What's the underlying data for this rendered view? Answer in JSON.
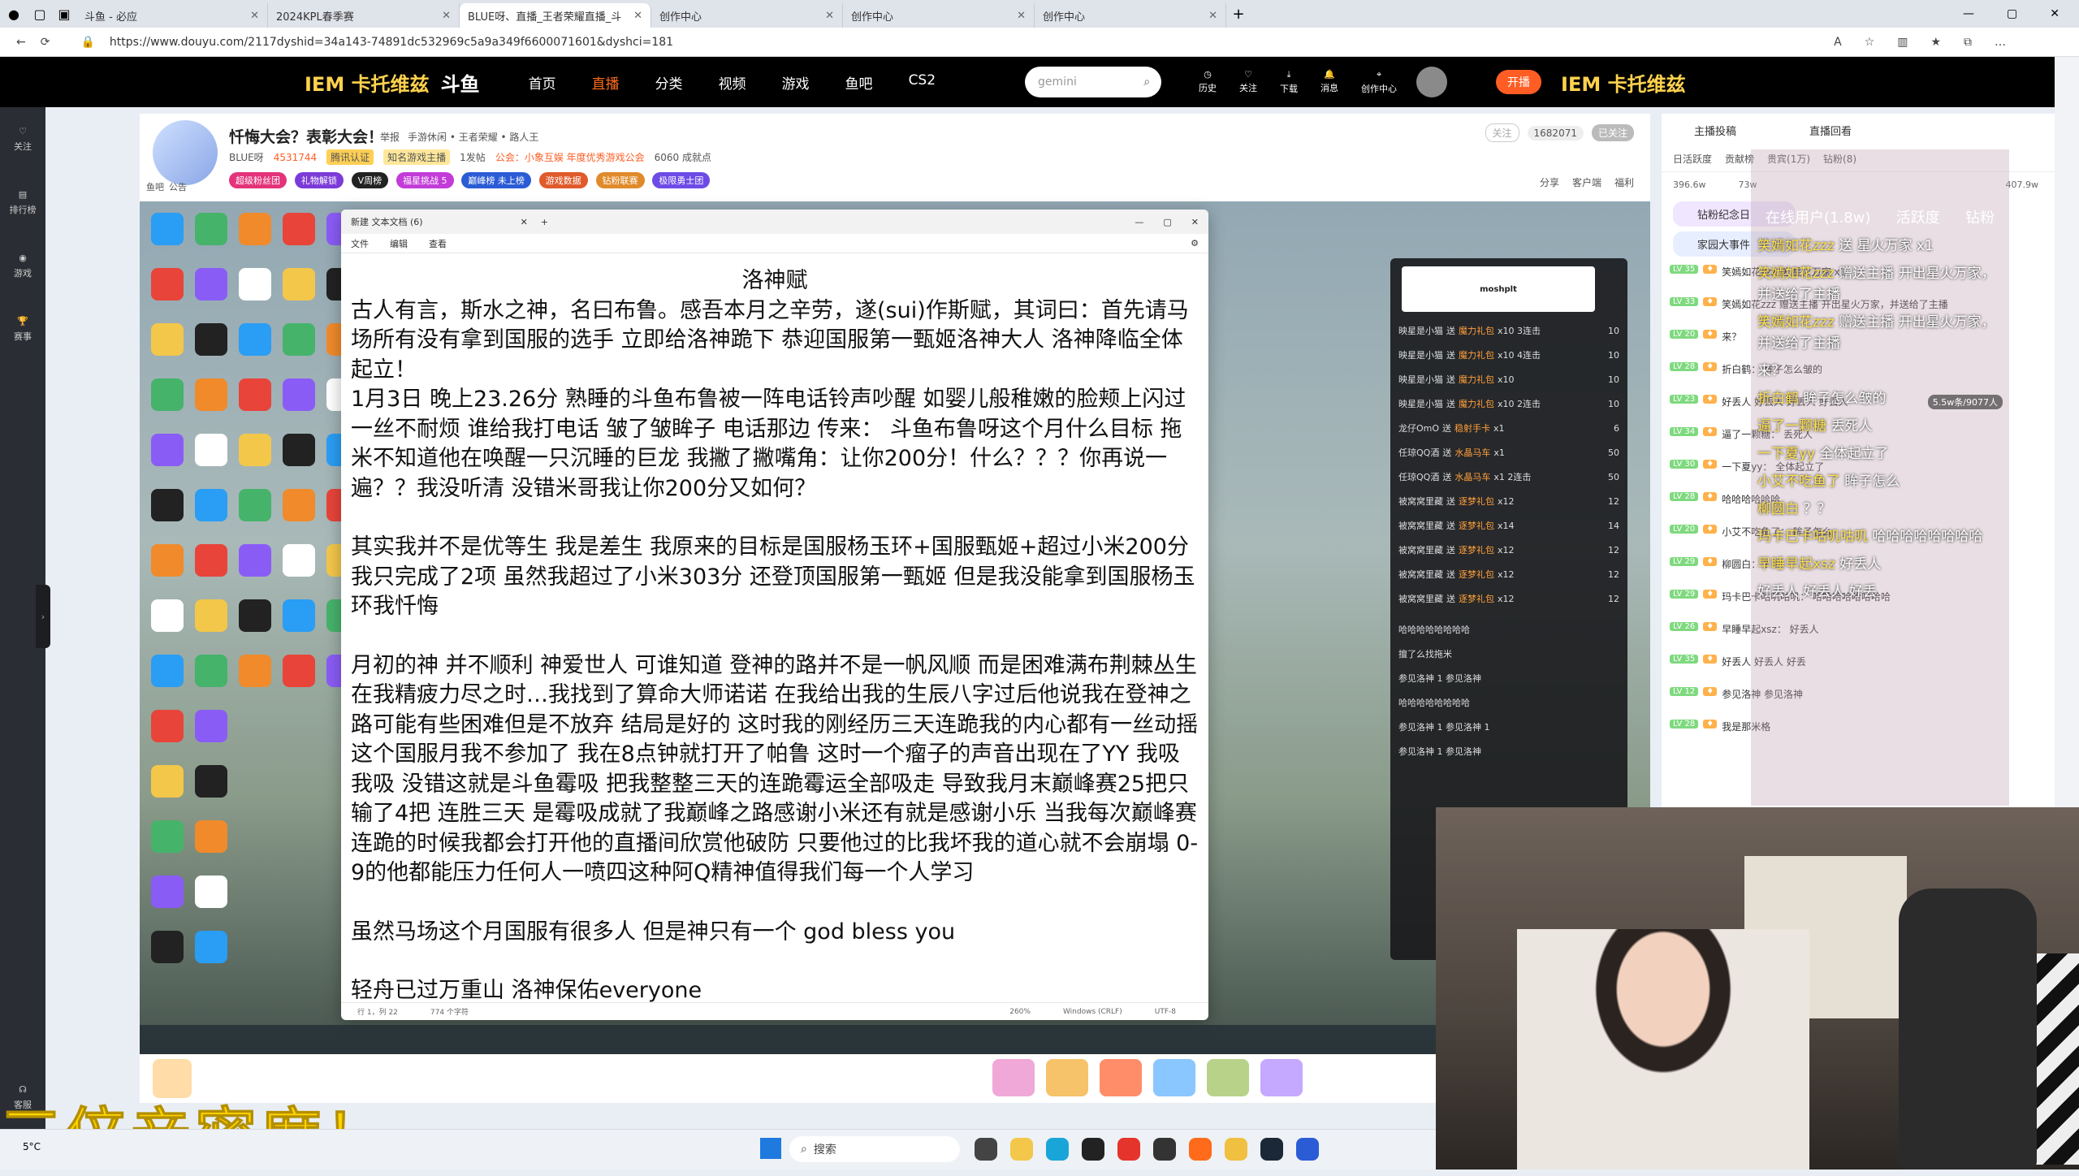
{
  "browser": {
    "tabs": [
      {
        "label": "斗鱼 - 必应"
      },
      {
        "label": "2024KPL春季赛"
      },
      {
        "label": "BLUE呀、直播_王者荣耀直播_斗"
      },
      {
        "label": "创作中心"
      },
      {
        "label": "创作中心"
      },
      {
        "label": "创作中心"
      }
    ],
    "url": "https://www.douyu.com/2117dyshid=34a143-74891dc532969c5a9a349f6600071601&dyshci=181"
  },
  "header": {
    "promo": "IEM 卡托维兹",
    "logo": "斗鱼",
    "nav": [
      "首页",
      "直播",
      "分类",
      "视频",
      "游戏",
      "鱼吧",
      "CS2"
    ],
    "nav_active": "直播",
    "search_placeholder": "gemini",
    "icons": [
      "历史",
      "关注",
      "下载",
      "消息",
      "创作中心"
    ],
    "open_live": "开播",
    "promo_right": "IEM 卡托维兹"
  },
  "sidebar": [
    "关注",
    "排行榜",
    "游戏",
    "赛事",
    "客服"
  ],
  "room": {
    "title": "忏悔大会？表彰大会！",
    "report": "举报",
    "category": "手游休闲 • 王者荣耀 • 路人王",
    "streamer": "BLUE呀",
    "hot": "4531744",
    "verified": "腾讯认证",
    "known": "知名游戏主播",
    "level": "1发帖",
    "notice": "公会：小象互娱 年度优秀游戏公会",
    "fans": "6060 成就点",
    "follow_btn": "关注",
    "followers": "1682071",
    "followed": "已关注",
    "room_tags": [
      "鱼吧",
      "公告"
    ],
    "pills": [
      "超级粉丝团",
      "礼物解锁",
      "V周榜",
      "福星挑战 5",
      "巅峰榜 未上榜",
      "游戏数据",
      "钻粉联赛",
      "极限勇士团"
    ],
    "actions": [
      "分享",
      "客户端",
      "福利"
    ]
  },
  "notepad": {
    "tab": "新建 文本文档 (6)",
    "menu": [
      "文件",
      "编辑",
      "查看"
    ],
    "title": "洛神赋",
    "paragraphs": [
      "古人有言，斯水之神，名曰布鲁。感吾本月之辛劳，遂(sui)作斯赋，其词曰：首先请马场所有没有拿到国服的选手 立即给洛神跪下 恭迎国服第一甄姬洛神大人 洛神降临全体起立！",
      "1月3日 晚上23.26分 熟睡的斗鱼布鲁被一阵电话铃声吵醒 如婴儿般稚嫩的脸颊上闪过一丝不耐烦 谁给我打电话 皱了皱眸子 电话那边 传来： 斗鱼布鲁呀这个月什么目标 拖米不知道他在唤醒一只沉睡的巨龙 我撇了撇嘴角：让你200分！什么？？？你再说一遍？？我没听清 没错米哥我让你200分又如何？",
      "其实我并不是优等生 我是差生 我原来的目标是国服杨玉环+国服甄姬+超过小米200分 我只完成了2项 虽然我超过了小米303分 还登顶国服第一甄姬 但是我没能拿到国服杨玉环我忏悔",
      "月初的神 并不顺利 神爱世人 可谁知道 登神的路并不是一帆风顺 而是困难满布荆棘丛生 在我精疲力尽之时…我找到了算命大师诺诺 在我给出我的生辰八字过后他说我在登神之路可能有些困难但是不放弃 结局是好的 这时我的刚经历三天连跪我的内心都有一丝动摇 这个国服月我不参加了 我在8点钟就打开了帕鲁 这时一个瘤子的声音出现在了YY 我吸我吸 没错这就是斗鱼霉吸 把我整整三天的连跪霉运全部吸走 导致我月末巅峰赛25把只输了4把 连胜三天 是霉吸成就了我巅峰之路感谢小米还有就是感谢小乐 当我每次巅峰赛连跪的时候我都会打开他的直播间欣赏他破防 只要他过的比我坏我的道心就不会崩塌 0-9的他都能压力任何人一喷四这种阿Q精神值得我们每一个人学习",
      "虽然马场这个月国服有很多人 但是神只有一个 god bless you",
      "轻舟已过万重山 洛神保佑everyone"
    ],
    "status": [
      "行 1，列 22",
      "774 个字符",
      "260%",
      "Windows (CRLF)",
      "UTF-8"
    ]
  },
  "mini_chat": {
    "streamer": "moshplt",
    "rows": [
      {
        "user": "映星是小猫",
        "gift": "魔力礼包",
        "combo": "x10 3连击",
        "n": "10"
      },
      {
        "user": "映星是小猫",
        "gift": "魔力礼包",
        "combo": "x10 4连击",
        "n": "10"
      },
      {
        "user": "映星是小猫",
        "gift": "魔力礼包",
        "combo": "x10",
        "n": "10"
      },
      {
        "user": "映星是小猫",
        "gift": "魔力礼包",
        "combo": "x10 2连击",
        "n": "10"
      },
      {
        "user": "龙仔OmO",
        "gift": "稳射手卡",
        "combo": "x1",
        "n": "6"
      },
      {
        "user": "任琼QQ酒",
        "gift": "水晶马车",
        "combo": "x1",
        "n": "50"
      },
      {
        "user": "任琼QQ酒",
        "gift": "水晶马车",
        "combo": "x1 2连击",
        "n": "50"
      },
      {
        "user": "被窝窝里藏",
        "gift": "逐梦礼包",
        "combo": "x12",
        "n": "12"
      },
      {
        "user": "被窝窝里藏",
        "gift": "逐梦礼包",
        "combo": "x14",
        "n": "14"
      },
      {
        "user": "被窝窝里藏",
        "gift": "逐梦礼包",
        "combo": "x12",
        "n": "12"
      },
      {
        "user": "被窝窝里藏",
        "gift": "逐梦礼包",
        "combo": "x12",
        "n": "12"
      },
      {
        "user": "被窝窝里藏",
        "gift": "逐梦礼包",
        "combo": "x12",
        "n": "12"
      }
    ],
    "messages": [
      "哈哈哈哈哈哈哈哈",
      "擅了么找拖米",
      "参见洛神 1 参见洛神",
      "哈哈哈哈哈哈哈哈",
      "参见洛神 1 参见洛神 1",
      "参见洛神 1 参见洛神"
    ]
  },
  "chat": {
    "top": [
      "主播投稿",
      "直播回看"
    ],
    "tabs": [
      "日活跃度",
      "贡献榜",
      "贵宾(1万)",
      "钻粉(8)"
    ],
    "online": "在线用户(1.8w)",
    "tabs2": [
      "活跃度",
      "钻粉"
    ],
    "stats": [
      "396.6w",
      "73w",
      "407.9w"
    ],
    "banners": [
      "钻粉纪念日",
      "家园大事件"
    ],
    "messages": [
      {
        "lv": "LV 35",
        "text": "笑嫣如花zzz 送 星火万家 x1"
      },
      {
        "lv": "LV 33",
        "text": "笑嫣如花zzz 赠送主播 开出星火万家，并送给了主播"
      },
      {
        "lv": "LV 20",
        "text": "来？"
      },
      {
        "lv": "LV 28",
        "text": "折白鹤： 眸子怎么皱的"
      },
      {
        "lv": "LV 23",
        "text": "好丢人 好丢人 好丢人 好丢人"
      },
      {
        "lv": "LV 34",
        "text": "逼了一颗糖： 丢死人"
      },
      {
        "lv": "LV 30",
        "text": "一下夏yy： 全体起立了"
      },
      {
        "lv": "LV 28",
        "text": "哈哈哈哈哈哈"
      },
      {
        "lv": "LV 20",
        "text": "小艾不吃鱼了： 眸子怎么"
      },
      {
        "lv": "LV 29",
        "text": "柳圆白： ？？"
      },
      {
        "lv": "LV 29",
        "text": "玛卡巴卡咕叽咕叽： 哈哈哈哈哈哈哈哈"
      },
      {
        "lv": "LV 26",
        "text": "早睡早起xsz： 好丢人"
      },
      {
        "lv": "LV 35",
        "text": "好丢人 好丢人 好丢"
      },
      {
        "lv": "LV 12",
        "text": "参见洛神 参见洛神"
      },
      {
        "lv": "LV 28",
        "text": "我是那米格"
      }
    ],
    "overlay_rows": [
      {
        "user": "笑嫣如花zzz",
        "text": "送 星火万家 x1"
      },
      {
        "user": "笑嫣如花zzz",
        "text": "赠送主播 开出星火万家，并送给了主播"
      },
      {
        "user": "笑嫣如花zzz",
        "text": "赠送主播 开出星火万家，并送给了主播"
      },
      {
        "user": "",
        "text": "来？"
      },
      {
        "user": "折白鹤",
        "text": "眸子怎么皱的"
      },
      {
        "user": "逼了一颗糖",
        "text": "丢死人"
      },
      {
        "user": "一下夏yy",
        "text": "全体起立了"
      },
      {
        "user": "小艾不吃鱼了",
        "text": "眸子怎么"
      },
      {
        "user": "柳圆白",
        "text": "？？"
      },
      {
        "user": "玛卡巴卡咕叽咕叽",
        "text": "哈哈哈哈哈哈哈哈"
      },
      {
        "user": "早睡早起xsz",
        "text": "好丢人"
      },
      {
        "user": "",
        "text": "好丢人 好丢人 好丢"
      }
    ],
    "viewer_count": "5.5w条/9077人"
  },
  "caption": "三倍亲密度！",
  "os_taskbar": {
    "weather": "5°C",
    "search": "搜索"
  },
  "colors": {
    "accent": "#ff6b1a",
    "promo": "#ffd24d",
    "caption": "#ffd400"
  }
}
